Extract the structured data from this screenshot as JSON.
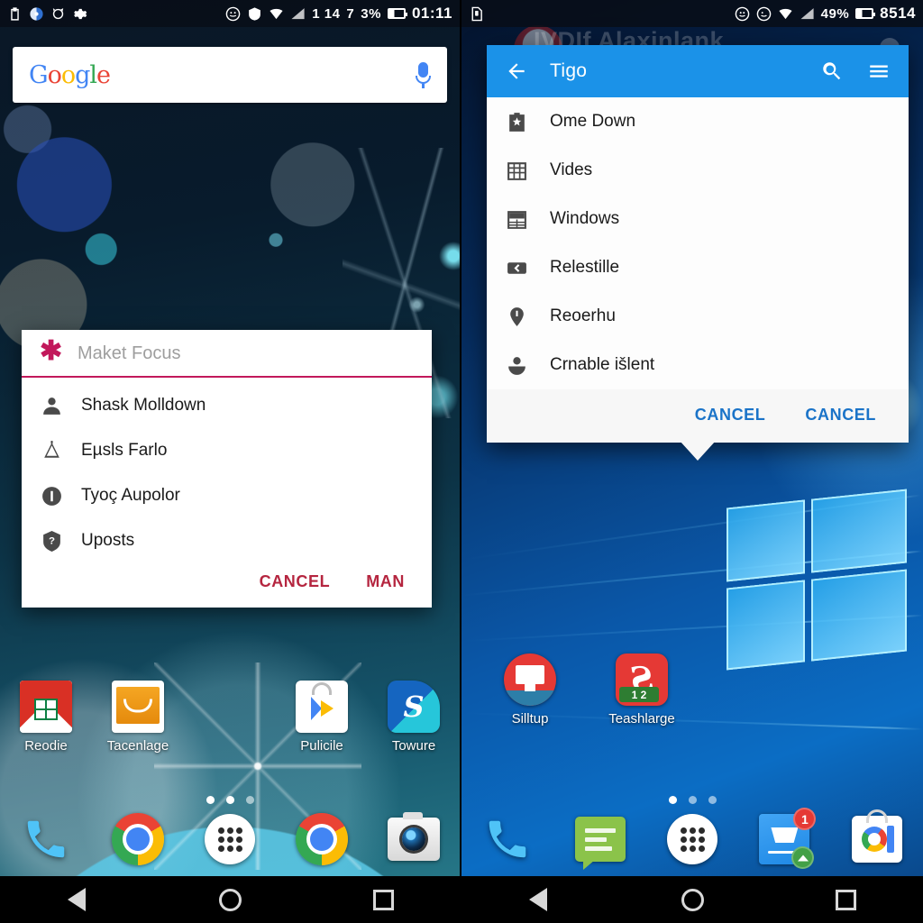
{
  "left_phone": {
    "status_bar": {
      "left_icons": [
        "clipboard-icon",
        "compass-icon",
        "alarm-icon",
        "settings-gear-icon"
      ],
      "right_icons": [
        "emoji-icon",
        "shield-check-icon",
        "wifi-icon",
        "signal-icon"
      ],
      "signal_text": "1 14",
      "sim_text": "7",
      "battery_percent": "3%",
      "clock": "01:11"
    },
    "search": {
      "logo_letters": [
        "G",
        "o",
        "o",
        "g",
        "l",
        "e"
      ],
      "placeholder": "",
      "mic_icon": "microphone-icon"
    },
    "dialog": {
      "title": "Maket Focus",
      "title_icon": "asterisk-icon",
      "accent_color": "#c2185b",
      "items": [
        {
          "label": "Shask Molldown",
          "icon": "person-icon"
        },
        {
          "label": "Eµsls Farlo",
          "icon": "bell-alert-icon"
        },
        {
          "label": "Tyoç Aupolor",
          "icon": "info-circle-icon"
        },
        {
          "label": "Uposts",
          "icon": "help-shield-icon"
        }
      ],
      "actions": [
        {
          "label": "CANCEL",
          "name": "cancel-button"
        },
        {
          "label": "MAN",
          "name": "man-button"
        }
      ],
      "action_color": "#b5253f"
    },
    "apps": [
      {
        "label": "Reodie",
        "icon": "gmail-icon"
      },
      {
        "label": "Tacenlage",
        "icon": "folder-icon"
      },
      {
        "label": "",
        "icon": ""
      },
      {
        "label": "Pulicile",
        "icon": "play-store-icon"
      },
      {
        "label": "Towure",
        "icon": "skype-s-icon"
      }
    ],
    "page_dots": {
      "count": 3,
      "active_index": 0
    },
    "dock": [
      {
        "icon": "phone-icon",
        "name": "dock-phone"
      },
      {
        "icon": "chrome-icon",
        "name": "dock-chrome"
      },
      {
        "icon": "app-drawer-icon",
        "name": "dock-app-drawer"
      },
      {
        "icon": "chrome-icon",
        "name": "dock-chrome-2"
      },
      {
        "icon": "camera-icon",
        "name": "dock-camera"
      }
    ],
    "nav_bar": [
      "back-nav-icon",
      "home-nav-icon",
      "recents-nav-icon"
    ]
  },
  "right_phone": {
    "status_bar": {
      "left_icons": [
        "sd-card-icon"
      ],
      "right_icons": [
        "emoji-icon",
        "alarm-icon",
        "wifi-icon",
        "signal-icon"
      ],
      "battery_percent": "49%",
      "clock": "8514"
    },
    "behind_title": "IVDIf Alaxinlank",
    "app_bar": {
      "back_icon": "back-arrow-icon",
      "title": "Tigo",
      "search_icon": "search-icon",
      "menu_icon": "hamburger-menu-icon",
      "color": "#1b92e8"
    },
    "menu_items": [
      {
        "label": "Ome Down",
        "icon": "star-badge-icon"
      },
      {
        "label": "Vides",
        "icon": "grid-icon"
      },
      {
        "label": "Windows",
        "icon": "table-icon"
      },
      {
        "label": "Relestille",
        "icon": "back-chevron-icon"
      },
      {
        "label": "Reoerhu",
        "icon": "location-pin-icon"
      },
      {
        "label": "Crnable išlent",
        "icon": "account-icon"
      }
    ],
    "actions": [
      {
        "label": "CANCEL",
        "name": "cancel-button-1"
      },
      {
        "label": "CANCEL",
        "name": "cancel-button-2"
      }
    ],
    "action_color": "#1a73c8",
    "apps": [
      {
        "label": "Silltup",
        "icon": "monitor-red-icon",
        "badge": ""
      },
      {
        "label": "Teashlarge",
        "icon": "s-red-icon",
        "badge": "1 2"
      }
    ],
    "page_dots": {
      "count": 3,
      "active_index": 0
    },
    "dock": [
      {
        "icon": "phone-icon",
        "name": "dock-phone",
        "badge": ""
      },
      {
        "icon": "messages-icon",
        "name": "dock-messages",
        "badge": ""
      },
      {
        "icon": "app-drawer-icon",
        "name": "dock-app-drawer",
        "badge": ""
      },
      {
        "icon": "cart-icon",
        "name": "dock-cart",
        "badge": "1"
      },
      {
        "icon": "play-store-icon",
        "name": "dock-play-store",
        "badge": ""
      }
    ],
    "nav_bar": [
      "back-nav-icon",
      "home-nav-icon",
      "recents-nav-icon"
    ]
  }
}
